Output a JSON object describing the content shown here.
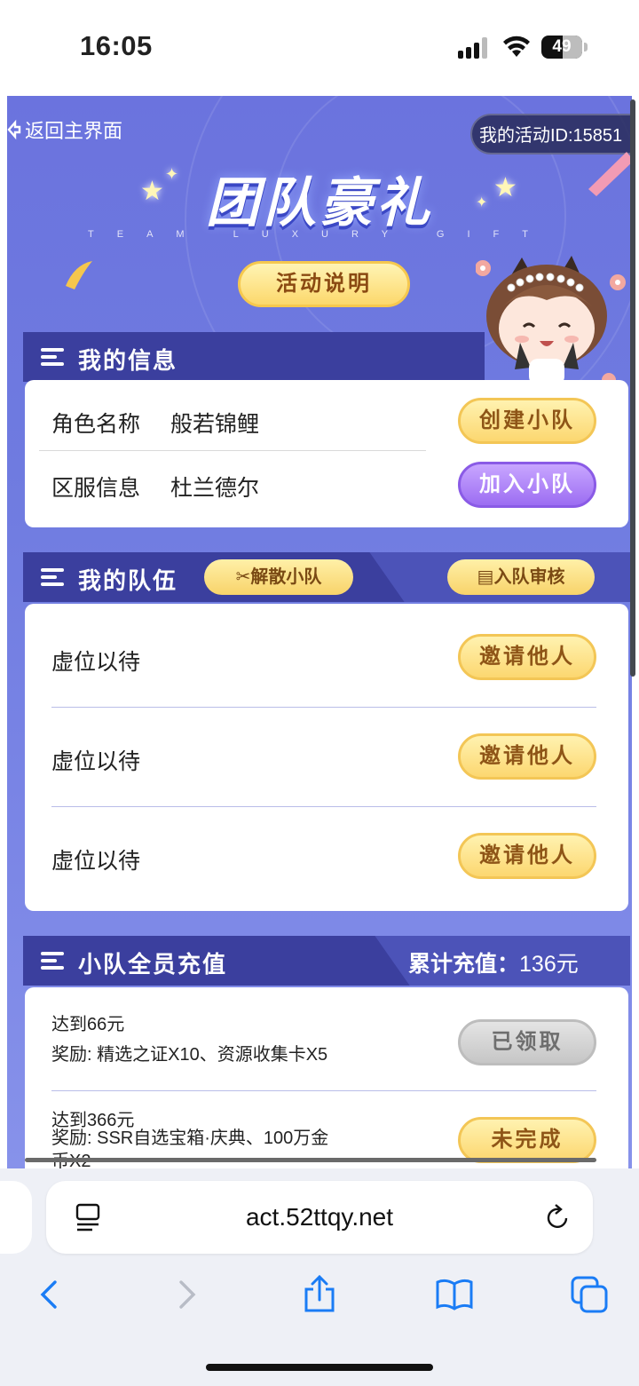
{
  "status_bar": {
    "time": "16:05",
    "battery": "49"
  },
  "page": {
    "back_label": "返回主界面",
    "activity_id": "我的活动ID:15851",
    "title": "团队豪礼",
    "subtitle": "TEAM LUXURY GIFT",
    "rules_button": "活动说明"
  },
  "my_info": {
    "header": "我的信息",
    "role_label": "角色名称",
    "role_value": "般若锦鲤",
    "server_label": "区服信息",
    "server_value": "杜兰德尔",
    "create_button": "创建小队",
    "join_button": "加入小队"
  },
  "my_team": {
    "header": "我的队伍",
    "disband_button": "解散小队",
    "review_button": "入队审核",
    "slots": [
      {
        "text": "虚位以待",
        "button": "邀请他人"
      },
      {
        "text": "虚位以待",
        "button": "邀请他人"
      },
      {
        "text": "虚位以待",
        "button": "邀请他人"
      }
    ]
  },
  "recharge": {
    "header": "小队全员充值",
    "total_label": "累计充值：",
    "total_value": "136元",
    "tiers": [
      {
        "target": "达到66元",
        "reward": "奖励: 精选之证X10、资源收集卡X5",
        "button": "已领取"
      },
      {
        "target": "达到366元",
        "reward": "奖励: SSR自选宝箱·庆典、100万金",
        "reward_line2": "币X2",
        "button": "未完成"
      }
    ]
  },
  "browser": {
    "url": "act.52ttqy.net"
  },
  "colors": {
    "page_bg": "#6f7be0",
    "header_bg": "#3b3f9e",
    "gold_button": "#fcd770",
    "purple_button": "#9c6df2"
  }
}
